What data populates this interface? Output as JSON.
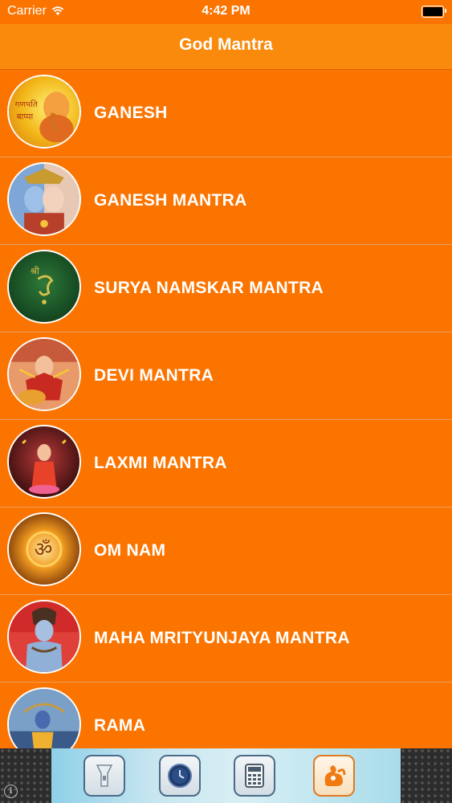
{
  "status_bar": {
    "carrier": "Carrier",
    "time": "4:42 PM"
  },
  "nav": {
    "title": "God Mantra"
  },
  "list": {
    "items": [
      {
        "label": "GANESH",
        "icon": "ganesh-image-icon"
      },
      {
        "label": "GANESH MANTRA",
        "icon": "shiva-parvati-image-icon"
      },
      {
        "label": "SURYA NAMSKAR MANTRA",
        "icon": "ganesh-green-image-icon"
      },
      {
        "label": "DEVI MANTRA",
        "icon": "durga-image-icon"
      },
      {
        "label": "LAXMI MANTRA",
        "icon": "laxmi-image-icon"
      },
      {
        "label": "OM NAM",
        "icon": "om-image-icon"
      },
      {
        "label": "MAHA MRITYUNJAYA MANTRA",
        "icon": "shiva-image-icon"
      },
      {
        "label": "RAMA",
        "icon": "rama-image-icon"
      }
    ]
  },
  "toolbar": {
    "buttons": [
      {
        "name": "flashlight",
        "icon": "flashlight-icon"
      },
      {
        "name": "clock",
        "icon": "clock-icon"
      },
      {
        "name": "calculator",
        "icon": "calculator-icon"
      },
      {
        "name": "browser",
        "icon": "squirrel-browser-icon"
      }
    ]
  },
  "colors": {
    "background": "#fb7400",
    "nav_bar": "#f98a0c",
    "text": "#ffffff"
  }
}
